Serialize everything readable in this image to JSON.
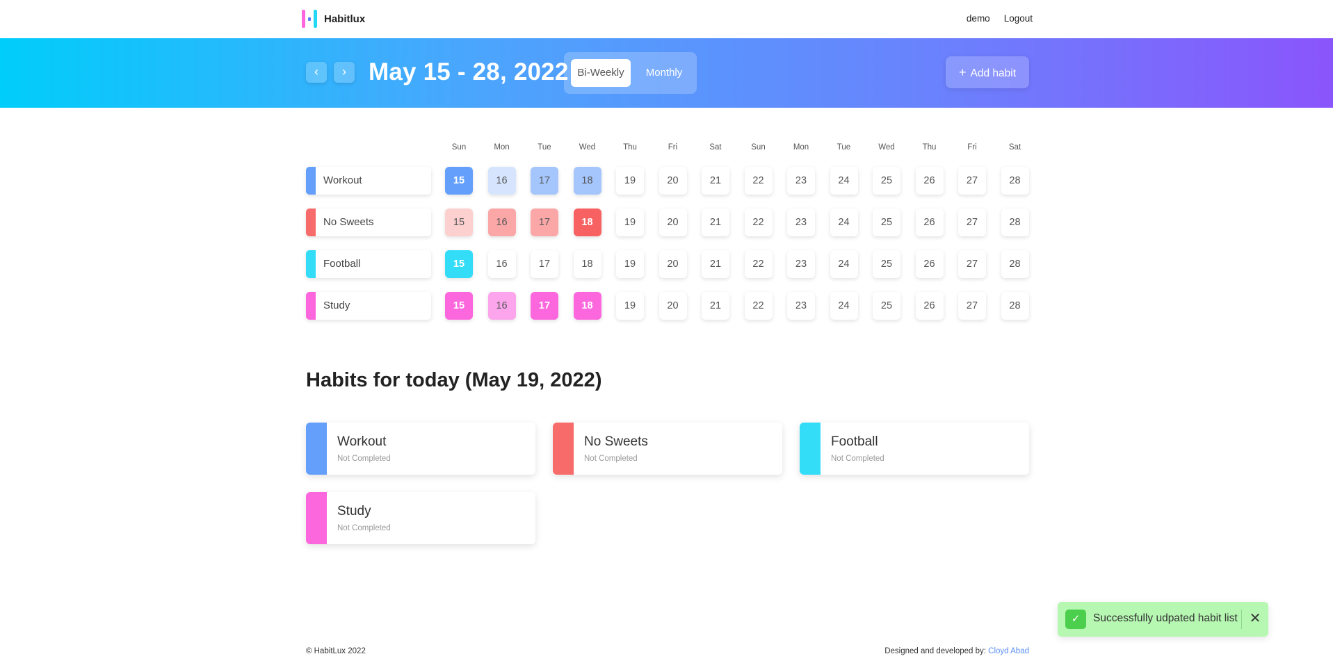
{
  "nav": {
    "brand": "Habitlux",
    "user": "demo",
    "logout": "Logout"
  },
  "hero": {
    "prev_icon": "chevron-left-icon",
    "next_icon": "chevron-right-icon",
    "prev_glyph": "‹",
    "next_glyph": "›",
    "date_range": "May 15 - 28, 2022",
    "view_options": [
      "Bi-Weekly",
      "Monthly"
    ],
    "active_view": "Bi-Weekly",
    "add_habit_label": "Add habit",
    "add_icon": "plus-icon"
  },
  "calendar": {
    "weekdays": [
      "Sun",
      "Mon",
      "Tue",
      "Wed",
      "Thu",
      "Fri",
      "Sat",
      "Sun",
      "Mon",
      "Tue",
      "Wed",
      "Thu",
      "Fri",
      "Sat"
    ],
    "dates": [
      "15",
      "16",
      "17",
      "18",
      "19",
      "20",
      "21",
      "22",
      "23",
      "24",
      "25",
      "26",
      "27",
      "28"
    ],
    "habits": [
      {
        "name": "Workout",
        "color": "#64a0fb",
        "days": [
          {
            "bg": "#64a0fb",
            "strong": true
          },
          {
            "bg": "#d6e5fd",
            "strong": false
          },
          {
            "bg": "#a5c6fc",
            "strong": false
          },
          {
            "bg": "#a5c6fc",
            "strong": false
          }
        ]
      },
      {
        "name": "No Sweets",
        "color": "#f86b6b",
        "days": [
          {
            "bg": "#fdd0d0",
            "strong": false
          },
          {
            "bg": "#fba7a7",
            "strong": false
          },
          {
            "bg": "#fba7a7",
            "strong": false
          },
          {
            "bg": "#f86161",
            "strong": true
          }
        ]
      },
      {
        "name": "Football",
        "color": "#33dcf7",
        "days": [
          {
            "bg": "#33dcf7",
            "strong": true
          },
          {
            "bg": "#ffffff",
            "strong": false
          },
          {
            "bg": "#ffffff",
            "strong": false
          },
          {
            "bg": "#ffffff",
            "strong": false
          }
        ]
      },
      {
        "name": "Study",
        "color": "#fd67de",
        "days": [
          {
            "bg": "#fd67de",
            "strong": true
          },
          {
            "bg": "#fda5ec",
            "strong": false
          },
          {
            "bg": "#fd67de",
            "strong": true
          },
          {
            "bg": "#fd67de",
            "strong": true
          }
        ]
      }
    ]
  },
  "today": {
    "title": "Habits for today (May 19, 2022)",
    "cards": [
      {
        "name": "Workout",
        "status": "Not Completed",
        "color": "#64a0fb"
      },
      {
        "name": "No Sweets",
        "status": "Not Completed",
        "color": "#f86b6b"
      },
      {
        "name": "Football",
        "status": "Not Completed",
        "color": "#33dcf7"
      },
      {
        "name": "Study",
        "status": "Not Completed",
        "color": "#fd67de"
      }
    ]
  },
  "footer": {
    "copyright": "© HabitLux 2022",
    "credit_prefix": "Designed and developed by: ",
    "credit_name": "Cloyd Abad"
  },
  "toast": {
    "message": "Successfully udpated habit list",
    "check_icon": "check-icon",
    "close_icon": "close-icon",
    "check_glyph": "✓",
    "close_glyph": "✕"
  }
}
